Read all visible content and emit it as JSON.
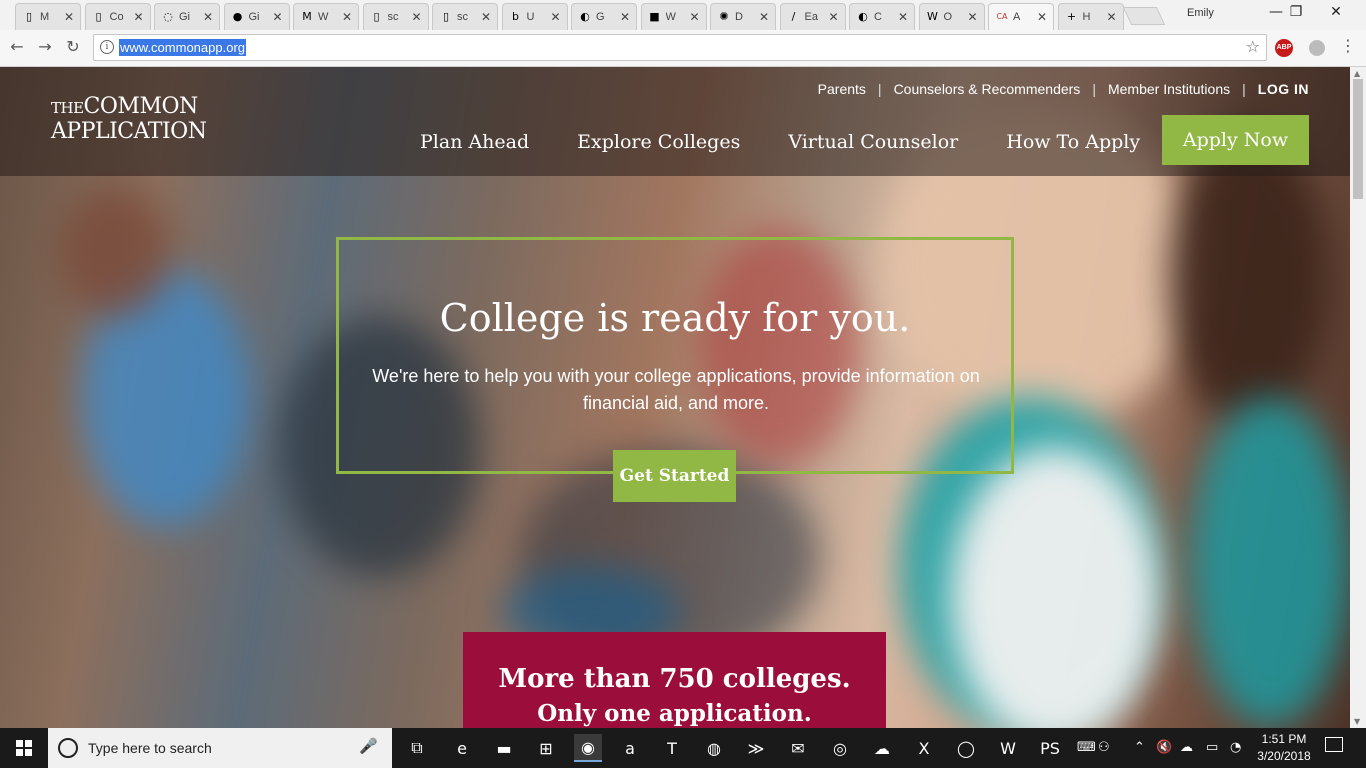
{
  "browser": {
    "tabs": [
      {
        "title": "M",
        "icon": "document-icon",
        "glyph": "▯"
      },
      {
        "title": "Co",
        "icon": "document-icon",
        "glyph": "▯"
      },
      {
        "title": "Gi",
        "icon": "spinner-icon",
        "glyph": "◌"
      },
      {
        "title": "Gi",
        "icon": "github-icon",
        "glyph": "●"
      },
      {
        "title": "W",
        "icon": "michigan-block-m-icon",
        "glyph": "M"
      },
      {
        "title": "sc",
        "icon": "document-icon",
        "glyph": "▯"
      },
      {
        "title": "sc",
        "icon": "document-icon",
        "glyph": "▯"
      },
      {
        "title": "U",
        "icon": "ubc-icon",
        "glyph": "b"
      },
      {
        "title": "G",
        "icon": "pie-icon",
        "glyph": "◐"
      },
      {
        "title": "W",
        "icon": "site-logo-icon",
        "glyph": "■"
      },
      {
        "title": "D",
        "icon": "sunburst-icon",
        "glyph": "✺"
      },
      {
        "title": "Ea",
        "icon": "slash-icon",
        "glyph": "/"
      },
      {
        "title": "C",
        "icon": "circle-logo-icon",
        "glyph": "◐"
      },
      {
        "title": "O",
        "icon": "w-logo-icon",
        "glyph": "W"
      },
      {
        "title": "A",
        "icon": "commonapp-favicon-icon",
        "glyph": "CA",
        "active": true
      },
      {
        "title": "H",
        "icon": "plus-square-icon",
        "glyph": "+"
      }
    ],
    "close_glyph": "✕",
    "profile_name": "Emily",
    "window": {
      "minimize": "—",
      "maximize": "❐",
      "close": "✕"
    },
    "nav": {
      "back": "←",
      "forward": "→",
      "reload": "↻"
    },
    "url": "www.commonapp.org",
    "info_glyph": "i",
    "bookmark_star": "☆",
    "adblock_label": "ABP",
    "menu_dots": "⋮"
  },
  "site": {
    "logo_line1_the": "THE",
    "logo_line1_rest": "COMMON",
    "logo_line2": "APPLICATION",
    "utility_nav": [
      "Parents",
      "Counselors & Recommenders",
      "Member Institutions"
    ],
    "utility_separator": "|",
    "login_label": "LOG IN",
    "main_nav": [
      "Plan Ahead",
      "Explore Colleges",
      "Virtual Counselor",
      "How To Apply"
    ],
    "apply_label": "Apply Now",
    "hero": {
      "title": "College is ready for you.",
      "subtitle": "We're here to help you with your college applications, provide information on financial aid, and more.",
      "cta": "Get Started"
    },
    "promo": {
      "line1": "More than 750 colleges.",
      "line2": "Only one application."
    },
    "colors": {
      "accent_green": "#91b844",
      "promo_maroon": "#9b0d3a"
    }
  },
  "taskbar": {
    "search_placeholder": "Type here to search",
    "mic_glyph": "🎤",
    "apps": [
      {
        "name": "task-view-icon",
        "glyph": "⧉"
      },
      {
        "name": "edge-icon",
        "glyph": "e"
      },
      {
        "name": "file-explorer-icon",
        "glyph": "▬"
      },
      {
        "name": "store-icon",
        "glyph": "⊞"
      },
      {
        "name": "chrome-icon",
        "glyph": "◉",
        "active": true
      },
      {
        "name": "amazon-icon",
        "glyph": "a"
      },
      {
        "name": "t-app-icon",
        "glyph": "T"
      },
      {
        "name": "firefox-icon",
        "glyph": "◍"
      },
      {
        "name": "media-app-icon",
        "glyph": "≫"
      },
      {
        "name": "mail-icon",
        "glyph": "✉"
      },
      {
        "name": "spotify-icon",
        "glyph": "◎"
      },
      {
        "name": "onedrive-icon",
        "glyph": "☁"
      },
      {
        "name": "excel-icon",
        "glyph": "X"
      },
      {
        "name": "app-circle-icon",
        "glyph": "◯"
      },
      {
        "name": "word-icon",
        "glyph": "W"
      },
      {
        "name": "phpstorm-icon",
        "glyph": "PS"
      }
    ],
    "tray_icons": [
      {
        "name": "keyboard-icon",
        "glyph": "⌨"
      },
      {
        "name": "people-icon",
        "glyph": "⚇"
      },
      {
        "name": "chevron-up-icon",
        "glyph": "⌃"
      },
      {
        "name": "volume-muted-icon",
        "glyph": "🔇"
      },
      {
        "name": "cloud-icon",
        "glyph": "☁"
      },
      {
        "name": "battery-icon",
        "glyph": "▭"
      },
      {
        "name": "wifi-icon",
        "glyph": "◔"
      }
    ],
    "time": "1:51 PM",
    "date": "3/20/2018"
  }
}
